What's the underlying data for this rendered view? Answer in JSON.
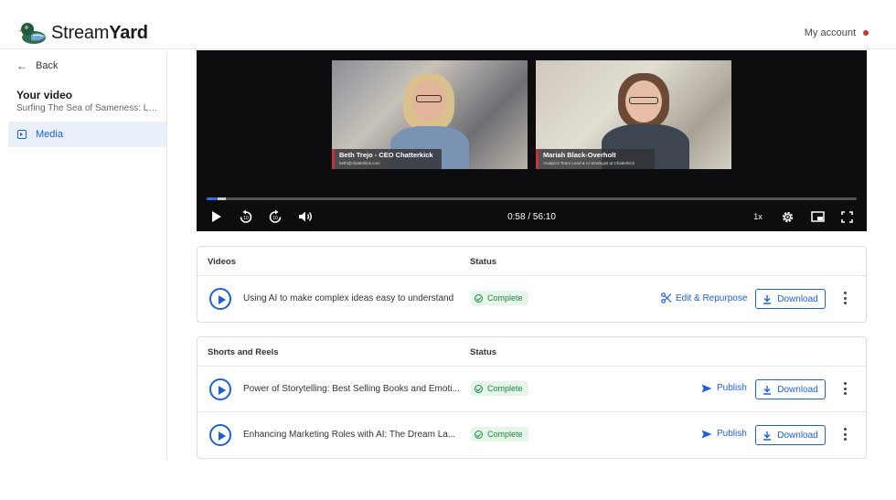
{
  "header": {
    "logo_text_light": "Stream",
    "logo_text_bold": "Yard",
    "account_label": "My account",
    "account_dot_color": "#d0303a"
  },
  "sidebar": {
    "back_label": "Back",
    "section_title": "Your video",
    "video_title": "Surfing The Sea of Sameness: Le...",
    "items": [
      {
        "label": "Media",
        "icon": "media-icon",
        "active": true
      }
    ]
  },
  "player": {
    "participants": [
      {
        "name": "Beth Trejo - CEO Chatterkick",
        "subtitle": "beth@chatterkick.com"
      },
      {
        "name": "Mariah Black-Overholt",
        "subtitle": "Analytics Team Lead & AI Strategist at Chatterkick"
      }
    ],
    "current_time": "0:58",
    "duration": "56:10",
    "time_display": "0:58 / 56:10",
    "progress_fraction": 0.017,
    "speed_label": "1x",
    "accent_color": "#2f6fe4",
    "controls": [
      "play-icon",
      "rewind-10-icon",
      "forward-10-icon",
      "volume-icon",
      "settings-gear-icon",
      "picture-in-picture-icon",
      "fullscreen-icon"
    ]
  },
  "videos": {
    "header_title": "Videos",
    "header_status": "Status",
    "rows": [
      {
        "title": "Using AI to make complex ideas easy to understand",
        "status": "Complete",
        "action": "Edit & Repurpose",
        "download": "Download"
      }
    ]
  },
  "shorts": {
    "header_title": "Shorts and Reels",
    "header_status": "Status",
    "rows": [
      {
        "title": "Power of Storytelling: Best Selling Books and Emoti...",
        "status": "Complete",
        "action": "Publish",
        "download": "Download"
      },
      {
        "title": "Enhancing Marketing Roles with AI: The Dream La...",
        "status": "Complete",
        "action": "Publish",
        "download": "Download"
      }
    ]
  },
  "colors": {
    "brand_blue": "#1f5fd6",
    "status_green": "#1e8a3e",
    "status_green_bg": "#e6f5ea"
  }
}
